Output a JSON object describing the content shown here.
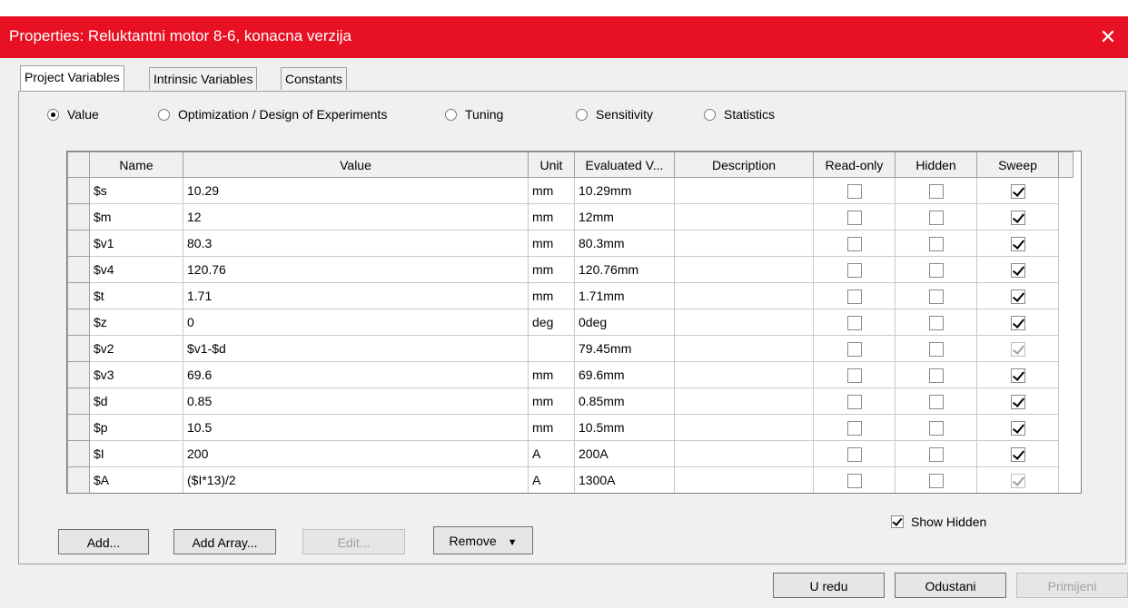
{
  "window": {
    "title": "Properties: Reluktantni motor 8-6, konacna verzija",
    "close_glyph": "✕"
  },
  "tabs": [
    {
      "label": "Project Variables",
      "active": true
    },
    {
      "label": "Intrinsic Variables",
      "active": false
    },
    {
      "label": "Constants",
      "active": false
    }
  ],
  "modes": [
    {
      "label": "Value",
      "selected": true
    },
    {
      "label": "Optimization / Design of Experiments",
      "selected": false
    },
    {
      "label": "Tuning",
      "selected": false
    },
    {
      "label": "Sensitivity",
      "selected": false
    },
    {
      "label": "Statistics",
      "selected": false
    }
  ],
  "table": {
    "columns": [
      "Name",
      "Value",
      "Unit",
      "Evaluated V...",
      "Description",
      "Read-only",
      "Hidden",
      "Sweep"
    ],
    "rows": [
      {
        "name": "$s",
        "value": "10.29",
        "unit": "mm",
        "evaluated": "10.29mm",
        "description": "",
        "read_only": false,
        "hidden": false,
        "sweep": true,
        "sweep_enabled": true
      },
      {
        "name": "$m",
        "value": "12",
        "unit": "mm",
        "evaluated": "12mm",
        "description": "",
        "read_only": false,
        "hidden": false,
        "sweep": true,
        "sweep_enabled": true
      },
      {
        "name": "$v1",
        "value": "80.3",
        "unit": "mm",
        "evaluated": "80.3mm",
        "description": "",
        "read_only": false,
        "hidden": false,
        "sweep": true,
        "sweep_enabled": true
      },
      {
        "name": "$v4",
        "value": "120.76",
        "unit": "mm",
        "evaluated": "120.76mm",
        "description": "",
        "read_only": false,
        "hidden": false,
        "sweep": true,
        "sweep_enabled": true
      },
      {
        "name": "$t",
        "value": "1.71",
        "unit": "mm",
        "evaluated": "1.71mm",
        "description": "",
        "read_only": false,
        "hidden": false,
        "sweep": true,
        "sweep_enabled": true
      },
      {
        "name": "$z",
        "value": "0",
        "unit": "deg",
        "evaluated": "0deg",
        "description": "",
        "read_only": false,
        "hidden": false,
        "sweep": true,
        "sweep_enabled": true
      },
      {
        "name": "$v2",
        "value": "$v1-$d",
        "unit": "",
        "evaluated": "79.45mm",
        "description": "",
        "read_only": false,
        "hidden": false,
        "sweep": true,
        "sweep_enabled": false
      },
      {
        "name": "$v3",
        "value": "69.6",
        "unit": "mm",
        "evaluated": "69.6mm",
        "description": "",
        "read_only": false,
        "hidden": false,
        "sweep": true,
        "sweep_enabled": true
      },
      {
        "name": "$d",
        "value": "0.85",
        "unit": "mm",
        "evaluated": "0.85mm",
        "description": "",
        "read_only": false,
        "hidden": false,
        "sweep": true,
        "sweep_enabled": true
      },
      {
        "name": "$p",
        "value": "10.5",
        "unit": "mm",
        "evaluated": "10.5mm",
        "description": "",
        "read_only": false,
        "hidden": false,
        "sweep": true,
        "sweep_enabled": true
      },
      {
        "name": "$I",
        "value": "200",
        "unit": "A",
        "evaluated": "200A",
        "description": "",
        "read_only": false,
        "hidden": false,
        "sweep": true,
        "sweep_enabled": true
      },
      {
        "name": "$A",
        "value": "($I*13)/2",
        "unit": "A",
        "evaluated": "1300A",
        "description": "",
        "read_only": false,
        "hidden": false,
        "sweep": true,
        "sweep_enabled": false
      }
    ]
  },
  "buttons": {
    "add": "Add...",
    "add_array": "Add Array...",
    "edit": "Edit...",
    "remove": "Remove",
    "remove_arrow": "▼",
    "ok": "U redu",
    "cancel": "Odustani",
    "apply": "Primijeni"
  },
  "show_hidden": {
    "label": "Show Hidden",
    "checked": true
  }
}
